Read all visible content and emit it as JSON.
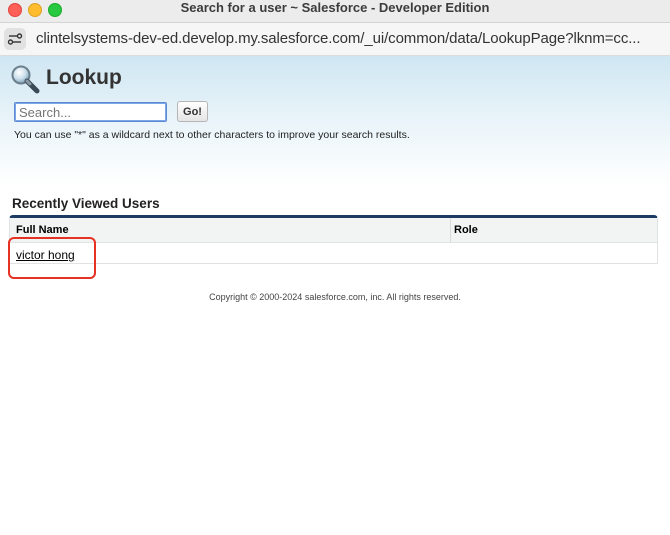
{
  "window": {
    "title": "Search for a user ~ Salesforce - Developer Edition",
    "controls": [
      "close",
      "minimize",
      "maximize"
    ]
  },
  "address_bar": {
    "url": "clintelsystems-dev-ed.develop.my.salesforce.com/_ui/common/data/LookupPage?lknm=cc...",
    "site_icon": "site-settings-icon"
  },
  "lookup": {
    "title": "Lookup",
    "icon": "magnifier-icon",
    "search_placeholder": "Search...",
    "go_label": "Go!",
    "hint": "You can use \"*\" as a wildcard next to other characters to improve your search results."
  },
  "recent": {
    "title": "Recently Viewed Users",
    "columns": [
      "Full Name",
      "Role"
    ],
    "rows": [
      {
        "full_name": "victor hong",
        "role": ""
      }
    ]
  },
  "footer": {
    "copyright": "Copyright © 2000-2024 salesforce.com, inc. All rights reserved."
  },
  "colors": {
    "header_gradient_top": "#cfe6f2",
    "table_top_border": "#1b3b63",
    "highlight_box": "#e53222"
  }
}
